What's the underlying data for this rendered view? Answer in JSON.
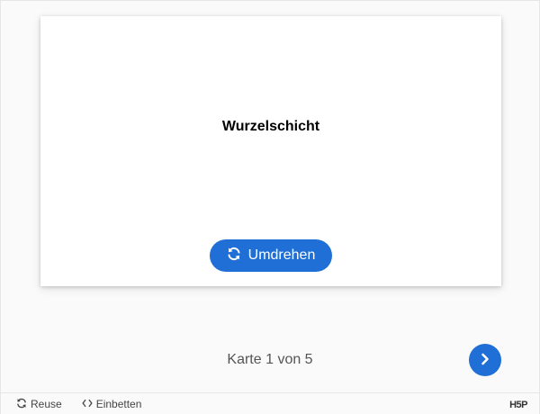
{
  "card": {
    "text": "Wurzelschicht",
    "flip_label": "Umdrehen"
  },
  "navigation": {
    "progress_text": "Karte 1 von 5",
    "next_icon": "chevron-right-icon"
  },
  "footer": {
    "reuse_label": "Reuse",
    "embed_label": "Einbetten",
    "logo_text": "H5P"
  },
  "colors": {
    "accent": "#1f6fd6",
    "background": "#fafafa",
    "card": "#ffffff"
  }
}
